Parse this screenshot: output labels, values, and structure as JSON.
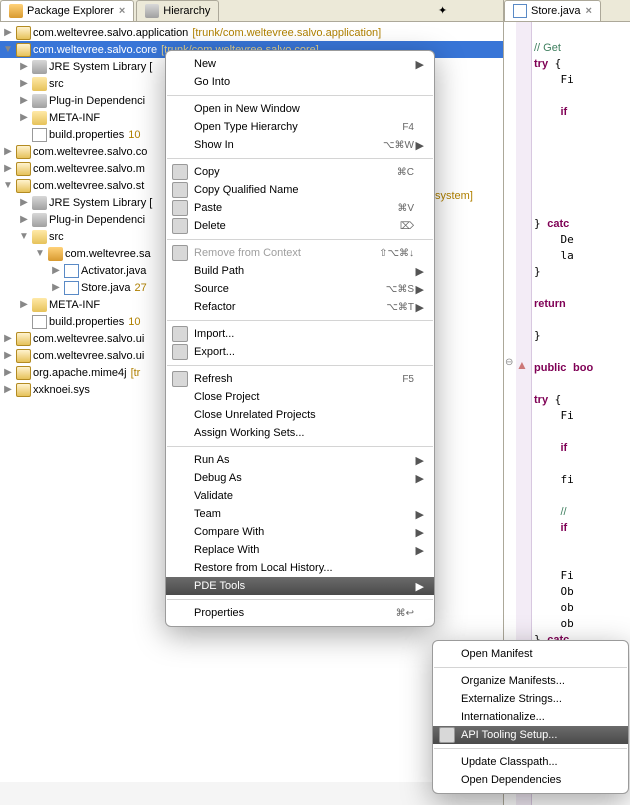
{
  "tabs": {
    "package_explorer": "Package Explorer",
    "hierarchy": "Hierarchy",
    "store_java": "Store.java"
  },
  "tree": [
    {
      "indent": 0,
      "twisty": "▶",
      "icon": "ico-proj",
      "label": "com.weltevree.salvo.application",
      "suffix": "[trunk/com.weltevree.salvo.application]",
      "name": "project-application"
    },
    {
      "indent": 0,
      "twisty": "▼",
      "icon": "ico-proj",
      "label": "com.weltevree.salvo.core",
      "suffix": "[trunk/com.weltevree.salvo.core]",
      "name": "project-core",
      "selected": true
    },
    {
      "indent": 1,
      "twisty": "▶",
      "icon": "ico-jar",
      "label": "JRE System Library [",
      "suffix": "",
      "name": "jre-lib"
    },
    {
      "indent": 1,
      "twisty": "▶",
      "icon": "ico-folder",
      "label": "src",
      "suffix": "",
      "name": "src-folder-1"
    },
    {
      "indent": 1,
      "twisty": "▶",
      "icon": "ico-jar",
      "label": "Plug-in Dependenci",
      "suffix": "",
      "name": "plugin-deps-1"
    },
    {
      "indent": 1,
      "twisty": "▶",
      "icon": "ico-folder",
      "label": "META-INF",
      "suffix": "",
      "name": "meta-inf-1"
    },
    {
      "indent": 1,
      "twisty": "",
      "icon": "ico-file",
      "label": "build.properties",
      "suffix": "10",
      "name": "build-props-1"
    },
    {
      "indent": 0,
      "twisty": "▶",
      "icon": "ico-proj",
      "label": "com.weltevree.salvo.co",
      "suffix": "",
      "name": "project-co"
    },
    {
      "indent": 0,
      "twisty": "▶",
      "icon": "ico-proj",
      "label": "com.weltevree.salvo.m",
      "suffix": "",
      "name": "project-m"
    },
    {
      "indent": 0,
      "twisty": "▼",
      "icon": "ico-proj",
      "label": "com.weltevree.salvo.st",
      "suffix": "",
      "name": "project-st"
    },
    {
      "indent": 1,
      "twisty": "▶",
      "icon": "ico-jar",
      "label": "JRE System Library [",
      "suffix": "",
      "name": "jre-lib-2"
    },
    {
      "indent": 1,
      "twisty": "▶",
      "icon": "ico-jar",
      "label": "Plug-in Dependenci",
      "suffix": "",
      "name": "plugin-deps-2"
    },
    {
      "indent": 1,
      "twisty": "▼",
      "icon": "ico-folder",
      "label": "src",
      "suffix": "",
      "name": "src-folder-2"
    },
    {
      "indent": 2,
      "twisty": "▼",
      "icon": "ico-package",
      "label": "com.weltevree.sa",
      "suffix": "",
      "name": "package-sa"
    },
    {
      "indent": 3,
      "twisty": "▶",
      "icon": "ico-java",
      "label": "Activator.java",
      "suffix": "",
      "name": "activator-java"
    },
    {
      "indent": 3,
      "twisty": "▶",
      "icon": "ico-java",
      "label": "Store.java",
      "suffix": "27",
      "name": "store-java"
    },
    {
      "indent": 1,
      "twisty": "▶",
      "icon": "ico-folder",
      "label": "META-INF",
      "suffix": "",
      "name": "meta-inf-2"
    },
    {
      "indent": 1,
      "twisty": "",
      "icon": "ico-file",
      "label": "build.properties",
      "suffix": "10",
      "name": "build-props-2"
    },
    {
      "indent": 0,
      "twisty": "▶",
      "icon": "ico-proj",
      "label": "com.weltevree.salvo.ui",
      "suffix": "",
      "name": "project-ui1"
    },
    {
      "indent": 0,
      "twisty": "▶",
      "icon": "ico-proj",
      "label": "com.weltevree.salvo.ui",
      "suffix": "",
      "name": "project-ui2"
    },
    {
      "indent": 0,
      "twisty": "▶",
      "icon": "ico-proj",
      "label": "org.apache.mime4j",
      "suffix": "[tr",
      "name": "project-mime4j"
    },
    {
      "indent": 0,
      "twisty": "▶",
      "icon": "ico-proj",
      "label": "xxknoei.sys",
      "suffix": "",
      "name": "project-xxknoei"
    }
  ],
  "tree_extra_suffix": "system]",
  "menu1": [
    {
      "type": "item",
      "label": "New",
      "arrow": true,
      "name": "menu-new"
    },
    {
      "type": "item",
      "label": "Go Into",
      "name": "menu-go-into"
    },
    {
      "type": "sep"
    },
    {
      "type": "item",
      "label": "Open in New Window",
      "name": "menu-open-new-window"
    },
    {
      "type": "item",
      "label": "Open Type Hierarchy",
      "shortcut": "F4",
      "name": "menu-open-type-hierarchy"
    },
    {
      "type": "item",
      "label": "Show In",
      "shortcut": "⌥⌘W",
      "arrow": true,
      "name": "menu-show-in"
    },
    {
      "type": "sep"
    },
    {
      "type": "item",
      "icon": true,
      "label": "Copy",
      "shortcut": "⌘C",
      "name": "menu-copy"
    },
    {
      "type": "item",
      "icon": true,
      "label": "Copy Qualified Name",
      "name": "menu-copy-qualified"
    },
    {
      "type": "item",
      "icon": true,
      "label": "Paste",
      "shortcut": "⌘V",
      "name": "menu-paste"
    },
    {
      "type": "item",
      "icon": true,
      "label": "Delete",
      "shortcut": "⌦",
      "name": "menu-delete"
    },
    {
      "type": "sep"
    },
    {
      "type": "item",
      "icon": true,
      "label": "Remove from Context",
      "shortcut": "⇧⌥⌘↓",
      "disabled": true,
      "name": "menu-remove-context"
    },
    {
      "type": "item",
      "label": "Build Path",
      "arrow": true,
      "name": "menu-build-path"
    },
    {
      "type": "item",
      "label": "Source",
      "shortcut": "⌥⌘S",
      "arrow": true,
      "name": "menu-source"
    },
    {
      "type": "item",
      "label": "Refactor",
      "shortcut": "⌥⌘T",
      "arrow": true,
      "name": "menu-refactor"
    },
    {
      "type": "sep"
    },
    {
      "type": "item",
      "icon": true,
      "label": "Import...",
      "name": "menu-import"
    },
    {
      "type": "item",
      "icon": true,
      "label": "Export...",
      "name": "menu-export"
    },
    {
      "type": "sep"
    },
    {
      "type": "item",
      "icon": true,
      "label": "Refresh",
      "shortcut": "F5",
      "name": "menu-refresh"
    },
    {
      "type": "item",
      "label": "Close Project",
      "name": "menu-close-project"
    },
    {
      "type": "item",
      "label": "Close Unrelated Projects",
      "name": "menu-close-unrelated"
    },
    {
      "type": "item",
      "label": "Assign Working Sets...",
      "name": "menu-assign-working-sets"
    },
    {
      "type": "sep"
    },
    {
      "type": "item",
      "label": "Run As",
      "arrow": true,
      "name": "menu-run-as"
    },
    {
      "type": "item",
      "label": "Debug As",
      "arrow": true,
      "name": "menu-debug-as"
    },
    {
      "type": "item",
      "label": "Validate",
      "name": "menu-validate"
    },
    {
      "type": "item",
      "label": "Team",
      "arrow": true,
      "name": "menu-team"
    },
    {
      "type": "item",
      "label": "Compare With",
      "arrow": true,
      "name": "menu-compare-with"
    },
    {
      "type": "item",
      "label": "Replace With",
      "arrow": true,
      "name": "menu-replace-with"
    },
    {
      "type": "item",
      "label": "Restore from Local History...",
      "name": "menu-restore-history"
    },
    {
      "type": "item",
      "label": "PDE Tools",
      "arrow": true,
      "highlighted": true,
      "name": "menu-pde-tools"
    },
    {
      "type": "sep"
    },
    {
      "type": "item",
      "label": "Properties",
      "shortcut": "⌘↩",
      "name": "menu-properties"
    }
  ],
  "menu2": [
    {
      "type": "item",
      "label": "Open Manifest",
      "name": "submenu-open-manifest"
    },
    {
      "type": "sep"
    },
    {
      "type": "item",
      "label": "Organize Manifests...",
      "name": "submenu-organize-manifests"
    },
    {
      "type": "item",
      "label": "Externalize Strings...",
      "name": "submenu-externalize-strings"
    },
    {
      "type": "item",
      "label": "Internationalize...",
      "name": "submenu-internationalize"
    },
    {
      "type": "item",
      "icon": true,
      "label": "API Tooling Setup...",
      "highlighted": true,
      "name": "submenu-api-tooling"
    },
    {
      "type": "sep"
    },
    {
      "type": "item",
      "label": "Update Classpath...",
      "name": "submenu-update-classpath"
    },
    {
      "type": "item",
      "label": "Open Dependencies",
      "name": "submenu-open-dependencies"
    }
  ],
  "editor": {
    "lines": [
      "",
      "// Get",
      "try {",
      "    Fi",
      "",
      "    if",
      "",
      "",
      "",
      "",
      "",
      "",
      "} catc",
      "    De",
      "    la",
      "}",
      "",
      "return",
      "",
      "}",
      "",
      "public boo",
      "",
      "try {",
      "    Fi",
      "",
      "    if",
      "",
      "    fi",
      "",
      "    //",
      "    if",
      "",
      "",
      "    Fi",
      "    Ob",
      "    ob",
      "    ob",
      "} catc"
    ]
  }
}
